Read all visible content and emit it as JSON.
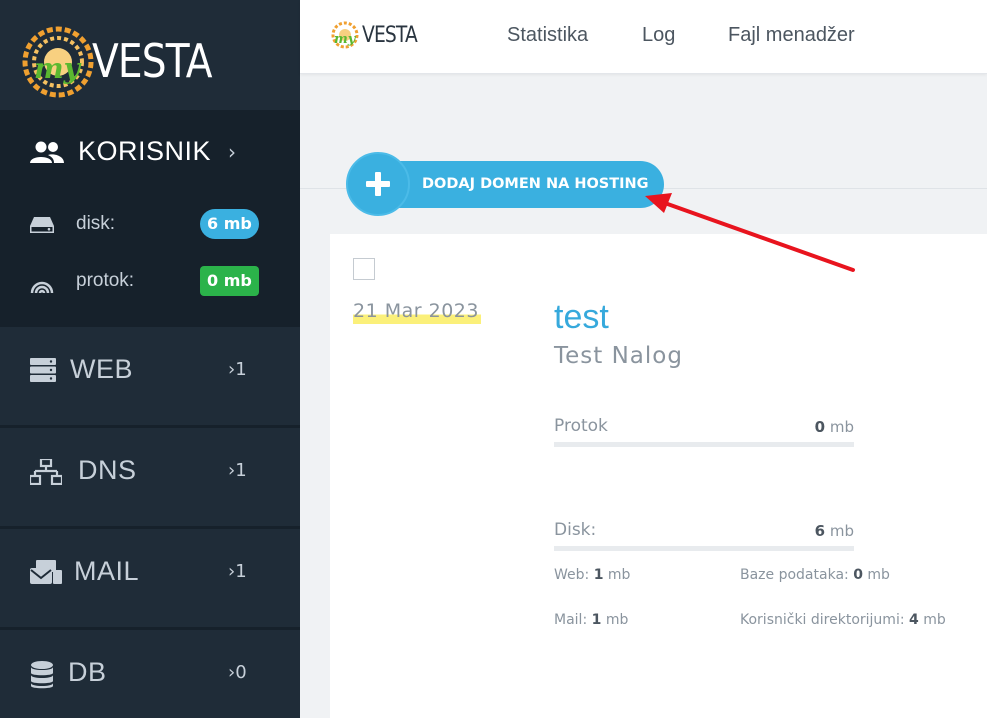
{
  "brand": {
    "logo_prefix": "my",
    "logo_name": "VESTA"
  },
  "sidebar": {
    "user": {
      "label": "KORISNIK",
      "chevron": "›",
      "icon": "users-icon"
    },
    "stats": [
      {
        "label": "disk:",
        "value": "6 mb",
        "icon": "hdd-icon",
        "color": "#3ab0e0"
      },
      {
        "label": "protok:",
        "value": "0 mb",
        "icon": "signal-icon",
        "color": "#2bb34a"
      }
    ],
    "items": [
      {
        "label": "WEB",
        "count": "›1",
        "icon": "server-icon"
      },
      {
        "label": "DNS",
        "count": "›1",
        "icon": "network-icon"
      },
      {
        "label": "MAIL",
        "count": "›1",
        "icon": "mail-icon"
      },
      {
        "label": "DB",
        "count": "›0",
        "icon": "database-icon"
      }
    ]
  },
  "topbar": {
    "nav": [
      {
        "label": "Statistika"
      },
      {
        "label": "Log"
      },
      {
        "label": "Fajl menadžer"
      }
    ]
  },
  "actions": {
    "add_domain": "DODAJ DOMEN NA HOSTING"
  },
  "card": {
    "date": "21  Mar  2023",
    "username": "test",
    "fullname": "Test Nalog",
    "protok": {
      "label": "Protok",
      "value": "0",
      "unit": "mb",
      "fraction": 0
    },
    "disk": {
      "label": "Disk:",
      "value": "6",
      "unit": "mb",
      "fraction": 0
    },
    "details": {
      "web": {
        "label": "Web:",
        "value": "1",
        "unit": "mb"
      },
      "baze": {
        "label": "Baze podataka:",
        "value": "0",
        "unit": "mb"
      },
      "mail": {
        "label": "Mail:",
        "value": "1",
        "unit": "mb"
      },
      "dirs": {
        "label": "Korisnički direktorijumi:",
        "value": "4",
        "unit": "mb"
      }
    }
  },
  "colors": {
    "accent": "#3ab0e0",
    "sidebar": "#1f2c38",
    "sidebar_dark": "#16212b",
    "annotation": "#e8141e"
  }
}
